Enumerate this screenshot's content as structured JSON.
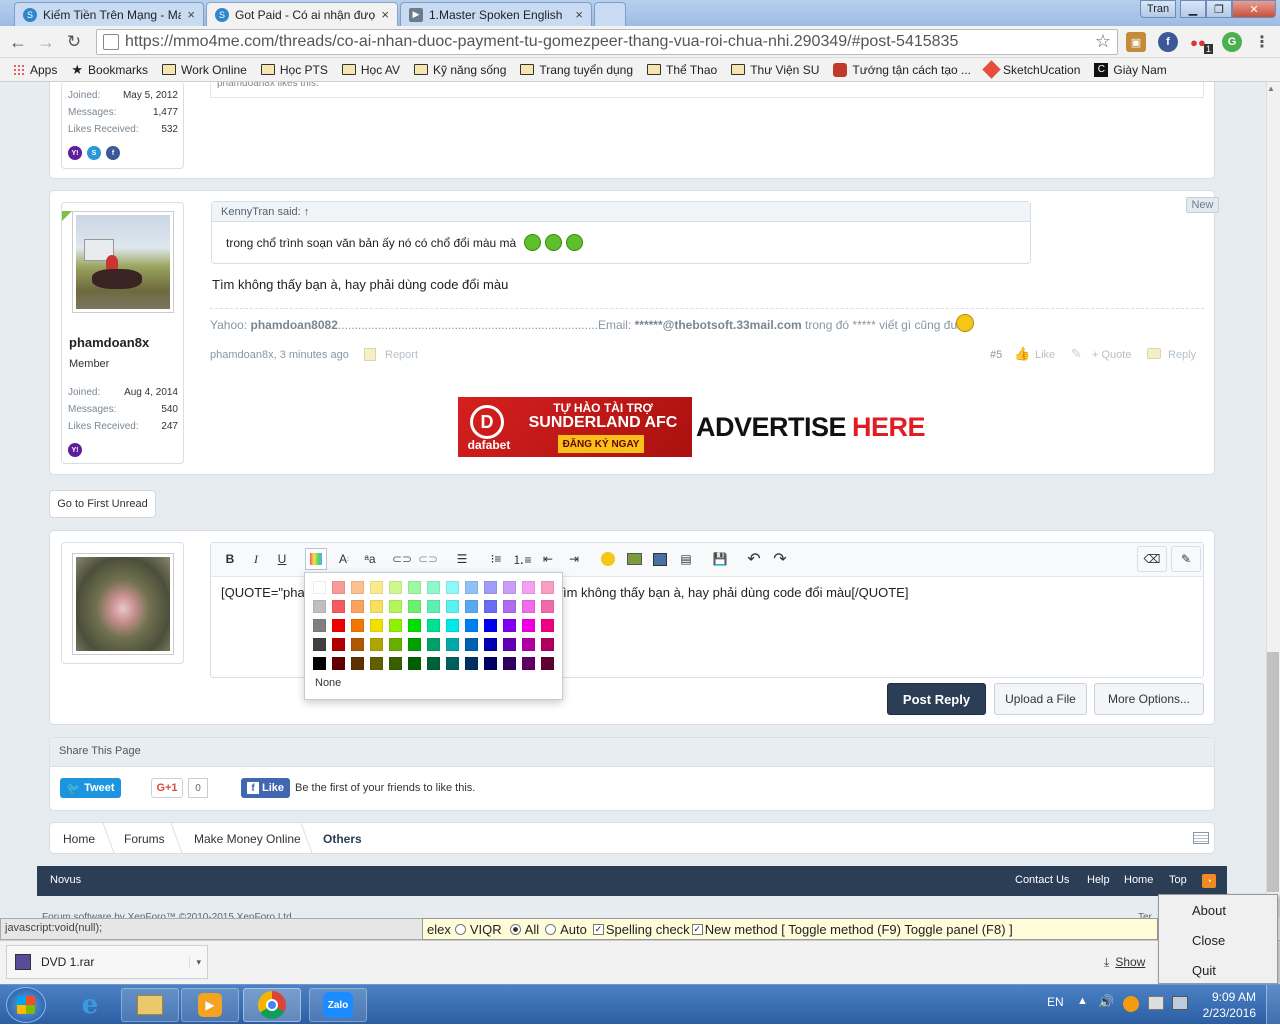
{
  "browser": {
    "tabs": [
      {
        "title": "Kiếm Tiền Trên Mạng - Ma",
        "icon": "site-s-icon",
        "color": "#2f86c9"
      },
      {
        "title": "Got Paid - Có ai nhận đượ",
        "icon": "site-s-icon",
        "color": "#2f86c9"
      },
      {
        "title": "1.Master Spoken English",
        "icon": "video-icon",
        "color": "#6b7b8e"
      }
    ],
    "user_badge": "Tran",
    "url": "https://mmo4me.com/threads/co-ai-nhan-duoc-payment-tu-gomezpeer-thang-vua-roi-chua-nhi.290349/#post-5415835",
    "extension_badge": "1",
    "bookmarks": [
      "Apps",
      "Bookmarks",
      "Work Online",
      "Học PTS",
      "Học AV",
      "Kỹ năng sống",
      "Trang tuyển dụng",
      "Thể Thao",
      "Thư Viện SU",
      "Tướng tận cách tạo ...",
      "SketchUcation",
      "Giày Nam"
    ]
  },
  "prev_user": {
    "joined_label": "Joined:",
    "joined": "May 5, 2012",
    "messages_label": "Messages:",
    "messages": "1,477",
    "likes_label": "Likes Received:",
    "likes": "532",
    "likes_line": "phamdoan8x likes this."
  },
  "post": {
    "new_badge": "New",
    "username": "phamdoan8x",
    "role": "Member",
    "joined_label": "Joined:",
    "joined": "Aug 4, 2014",
    "messages_label": "Messages:",
    "messages": "540",
    "likes_label": "Likes Received:",
    "likes": "247",
    "quote_author": "KennyTran said: ↑",
    "quote_text": "trong chổ trình soạn văn bản ấy nó có chổ đổi màu mà",
    "body": "Tìm không thấy bạn à, hay phải dùng code đổi màu",
    "sig_yahoo_label": "Yahoo:",
    "sig_yahoo": "phamdoan8082",
    "sig_dots": "..............................................................................",
    "sig_email_label": "Email:",
    "sig_email": "******@thebotsoft.33mail.com",
    "sig_tail": "trong đó ***** viết gì cũng được",
    "meta": "phamdoan8x, 3 minutes ago",
    "report": "Report",
    "number": "#5",
    "like": "Like",
    "quote_action": "+ Quote",
    "reply": "Reply"
  },
  "ads": {
    "dafabet_title1": "TỰ HÀO TÀI TRỢ",
    "dafabet_title2": "SUNDERLAND AFC",
    "dafabet_cta": "ĐĂNG KÝ NGAY",
    "dafabet_brand": "dafabet",
    "advertise_a": "ADVERTISE ",
    "advertise_b": "HERE"
  },
  "go_first_unread": "Go to First Unread",
  "editor": {
    "content_a": "[QUOTE=\"pha",
    "content_b": "ìm không thấy bạn à, hay phải dùng code đổi màu[/QUOTE]",
    "color_none": "None",
    "post_reply": "Post Reply",
    "upload": "Upload a File",
    "more_options": "More Options..."
  },
  "share": {
    "title": "Share This Page",
    "tweet": "Tweet",
    "gplus": "G+1",
    "gplus_count": "0",
    "like": "Like",
    "like_text": "Be the first of your friends to like this."
  },
  "breadcrumb": [
    "Home",
    "Forums",
    "Make Money Online",
    "Others"
  ],
  "footer": {
    "style_name": "Novus",
    "links": [
      "Contact Us",
      "Help",
      "Home",
      "Top"
    ],
    "copyright": "Forum software by XenForo™ ©2010-2015 XenForo Ltd.",
    "copyright_right": "Ter"
  },
  "statusbar": "javascript:void(null);",
  "vietkey": {
    "a": "elex",
    "b": "VIQR",
    "c": "All",
    "d": "Auto",
    "e": "Spelling check",
    "f": "New method [ Toggle method (F9) Toggle panel (F8) ]"
  },
  "download": {
    "file": "DVD 1.rar",
    "show": "Show"
  },
  "context_menu": [
    "About",
    "Close",
    "Quit"
  ],
  "taskbar": {
    "lang": "EN",
    "time": "9:09 AM",
    "date": "2/23/2016",
    "zalo": "Zalo"
  },
  "colors": {
    "palette": [
      [
        "#ffffff",
        "#f79a9a",
        "#fbc08e",
        "#fbe98e",
        "#cef88e",
        "#9ef8a0",
        "#8ef8c9",
        "#8ef8f8",
        "#8ec2f8",
        "#9e9ef8",
        "#c99ef8",
        "#f89ef2",
        "#f89ec2"
      ],
      [
        "#bfbfbf",
        "#f45c5c",
        "#f9a45c",
        "#f9e05c",
        "#b4f55c",
        "#6cf06e",
        "#5cf0b0",
        "#5cf0f0",
        "#5ca8f0",
        "#6c6cf0",
        "#b06cf0",
        "#f06ce8",
        "#f06ca8"
      ],
      [
        "#808080",
        "#f00000",
        "#f07800",
        "#f0e000",
        "#90f000",
        "#00e000",
        "#00e090",
        "#00e8e8",
        "#0080f0",
        "#0000f0",
        "#8000f0",
        "#f000e0",
        "#f00080"
      ],
      [
        "#404040",
        "#b00000",
        "#b05800",
        "#b0a400",
        "#68b000",
        "#00a000",
        "#00a068",
        "#00a8a8",
        "#0060b0",
        "#0000b0",
        "#6000b0",
        "#b000a4",
        "#b00060"
      ],
      [
        "#000000",
        "#600000",
        "#603000",
        "#606000",
        "#386000",
        "#006000",
        "#006038",
        "#006060",
        "#003060",
        "#000060",
        "#300060",
        "#600060",
        "#600030"
      ]
    ],
    "footer_bar": "#2b3e55",
    "post_reply_btn": "#2b3e55"
  }
}
